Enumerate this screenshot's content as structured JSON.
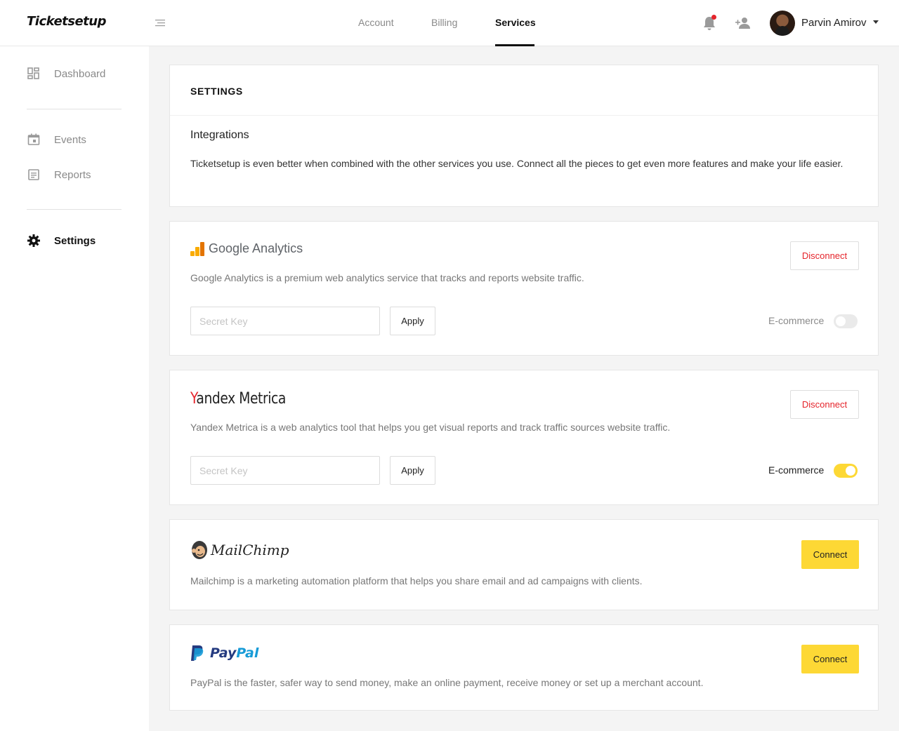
{
  "app": {
    "logo": "Ticketsetup"
  },
  "header": {
    "tabs": [
      {
        "label": "Account",
        "active": false
      },
      {
        "label": "Billing",
        "active": false
      },
      {
        "label": "Services",
        "active": true
      }
    ],
    "user": {
      "name": "Parvin Amirov"
    },
    "notification_dot_color": "#e5242b"
  },
  "sidebar": {
    "items": [
      {
        "label": "Dashboard",
        "icon": "dashboard-icon",
        "active": false
      },
      {
        "label": "Events",
        "icon": "calendar-icon",
        "active": false
      },
      {
        "label": "Reports",
        "icon": "reports-icon",
        "active": false
      },
      {
        "label": "Settings",
        "icon": "gear-icon",
        "active": true
      }
    ]
  },
  "settings": {
    "title": "SETTINGS",
    "integrations_title": "Integrations",
    "integrations_desc": "Ticketsetup is even better when combined with the other services you use. Connect all the pieces to get even more features and make your life easier."
  },
  "services": {
    "google": {
      "name": "Google Analytics",
      "desc": "Google Analytics is a premium web analytics service that tracks and reports website traffic.",
      "action": "Disconnect",
      "key_placeholder": "Secret Key",
      "apply": "Apply",
      "ecommerce_label": "E-commerce",
      "ecommerce_on": false
    },
    "yandex": {
      "name_first": "Y",
      "name_rest": "andex Metrica",
      "desc": "Yandex Metrica is a web analytics tool that helps you get visual reports and track traffic sources website traffic.",
      "action": "Disconnect",
      "key_placeholder": "Secret Key",
      "apply": "Apply",
      "ecommerce_label": "E-commerce",
      "ecommerce_on": true
    },
    "mailchimp": {
      "name": "MailChimp",
      "desc": "Mailchimp is a marketing automation platform that helps you share email and ad campaigns with clients.",
      "action": "Connect"
    },
    "paypal": {
      "name_a": "Pay",
      "name_b": "Pal",
      "desc": "PayPal is the faster, safer way to send money, make an online payment, receive money or set up a merchant account.",
      "action": "Connect"
    }
  },
  "colors": {
    "accent_yellow": "#fdd835",
    "danger_red": "#e5242b",
    "paypal_dark": "#253b80",
    "paypal_light": "#179bd7"
  }
}
